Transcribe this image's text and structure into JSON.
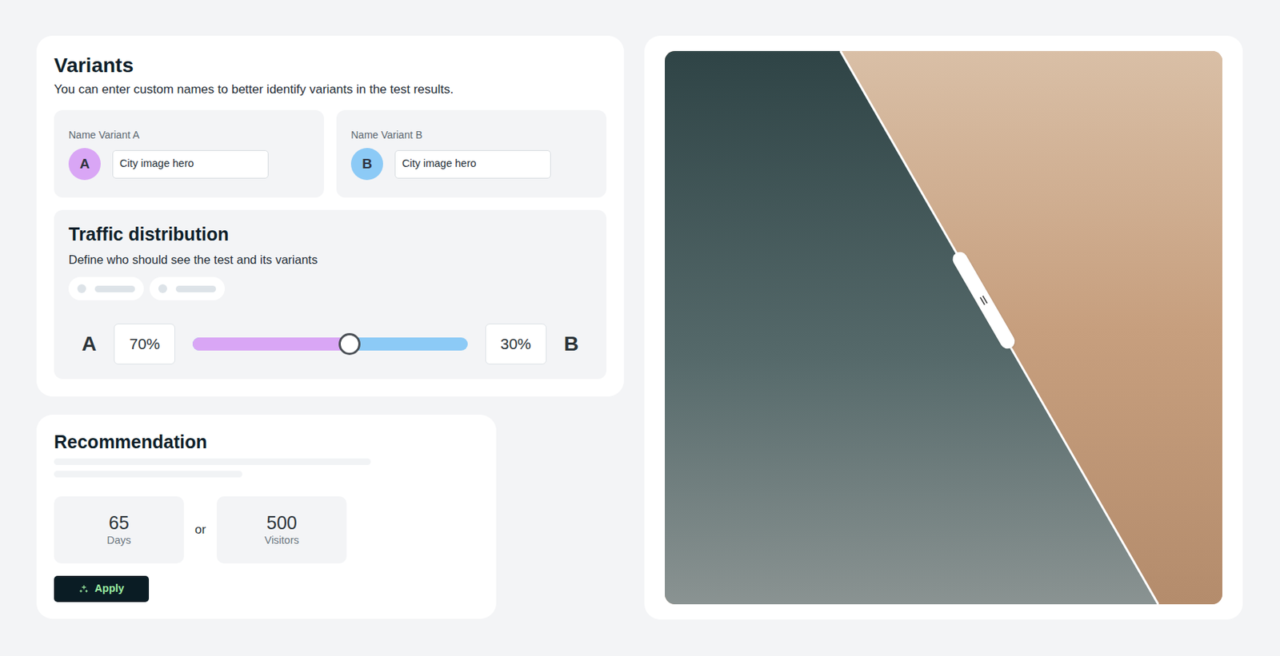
{
  "variants": {
    "title": "Variants",
    "description": "You can enter custom names to better identify variants in the test results.",
    "items": [
      {
        "label": "Name Variant A",
        "badge": "A",
        "value": "City image hero",
        "color": "#d9a6f5"
      },
      {
        "label": "Name Variant B",
        "badge": "B",
        "value": "City image hero",
        "color": "#8ccaf6"
      }
    ]
  },
  "traffic": {
    "title": "Traffic distribution",
    "description": "Define who should see the test and its variants",
    "options": [
      {
        "selected": false
      },
      {
        "selected": false
      }
    ],
    "a": {
      "label": "A",
      "value": "70%"
    },
    "b": {
      "label": "B",
      "value": "30%"
    },
    "level": 0.57
  },
  "recommendation": {
    "title": "Recommendation",
    "stats": [
      {
        "value": "65",
        "label": "Days"
      },
      {
        "value": "500",
        "label": "Visitors"
      }
    ],
    "separator": "or",
    "button": "Apply"
  },
  "comparison": {
    "level": 0.57
  }
}
